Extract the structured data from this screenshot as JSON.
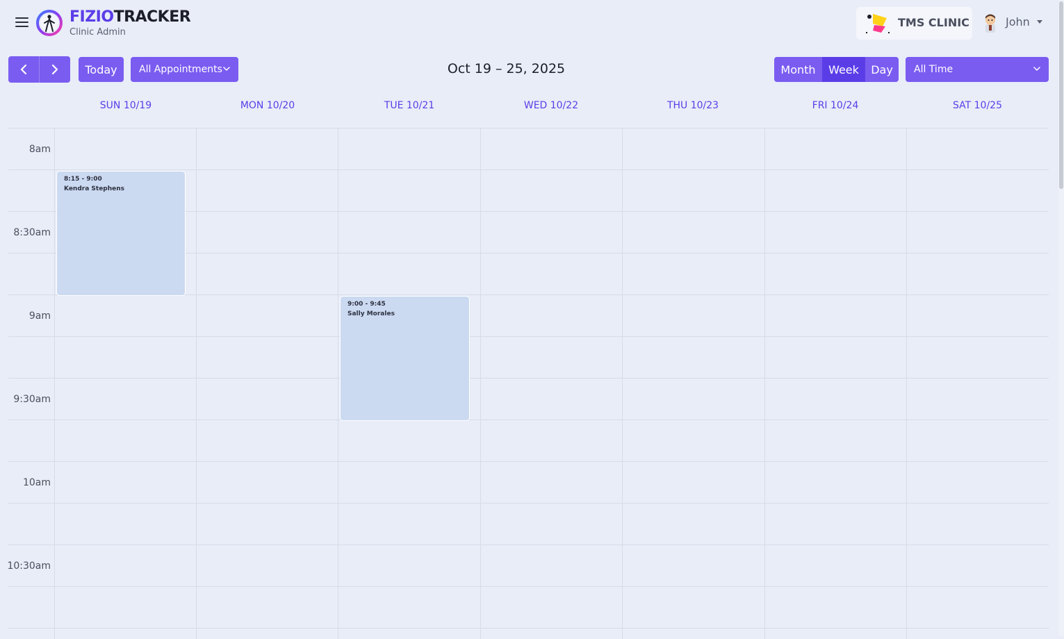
{
  "header": {
    "brand_part1": "FIZIO",
    "brand_part2": "TRACKER",
    "subtitle": "Clinic Admin",
    "clinic_name": "TMS CLINIC",
    "user_name": "John"
  },
  "toolbar": {
    "today_label": "Today",
    "filter_label": "All Appointments",
    "date_range": "Oct 19 – 25, 2025",
    "views": [
      "Month",
      "Week",
      "Day"
    ],
    "active_view": "Week",
    "time_filter_label": "All Time"
  },
  "calendar": {
    "days": [
      "SUN 10/19",
      "MON 10/20",
      "TUE 10/21",
      "WED 10/22",
      "THU 10/23",
      "FRI 10/24",
      "SAT 10/25"
    ],
    "time_labels": [
      "8am",
      "8:30am",
      "9am",
      "9:30am",
      "10am",
      "10:30am"
    ],
    "events": [
      {
        "day": "SUN 10/19",
        "time": "8:15 - 9:00",
        "title": "Kendra Stephens"
      },
      {
        "day": "TUE 10/21",
        "time": "9:00 - 9:45",
        "title": "Sally Morales"
      }
    ]
  },
  "colors": {
    "accent": "#7a5cf0",
    "accent_active": "#5b3de8",
    "event_bg": "#cbd9f1",
    "page_bg": "#e8edf8"
  },
  "icons": [
    "menu-icon",
    "fiziotracker-logo",
    "clinic-logo",
    "user-avatar",
    "chevron-left-icon",
    "chevron-right-icon",
    "chevron-down-icon"
  ]
}
